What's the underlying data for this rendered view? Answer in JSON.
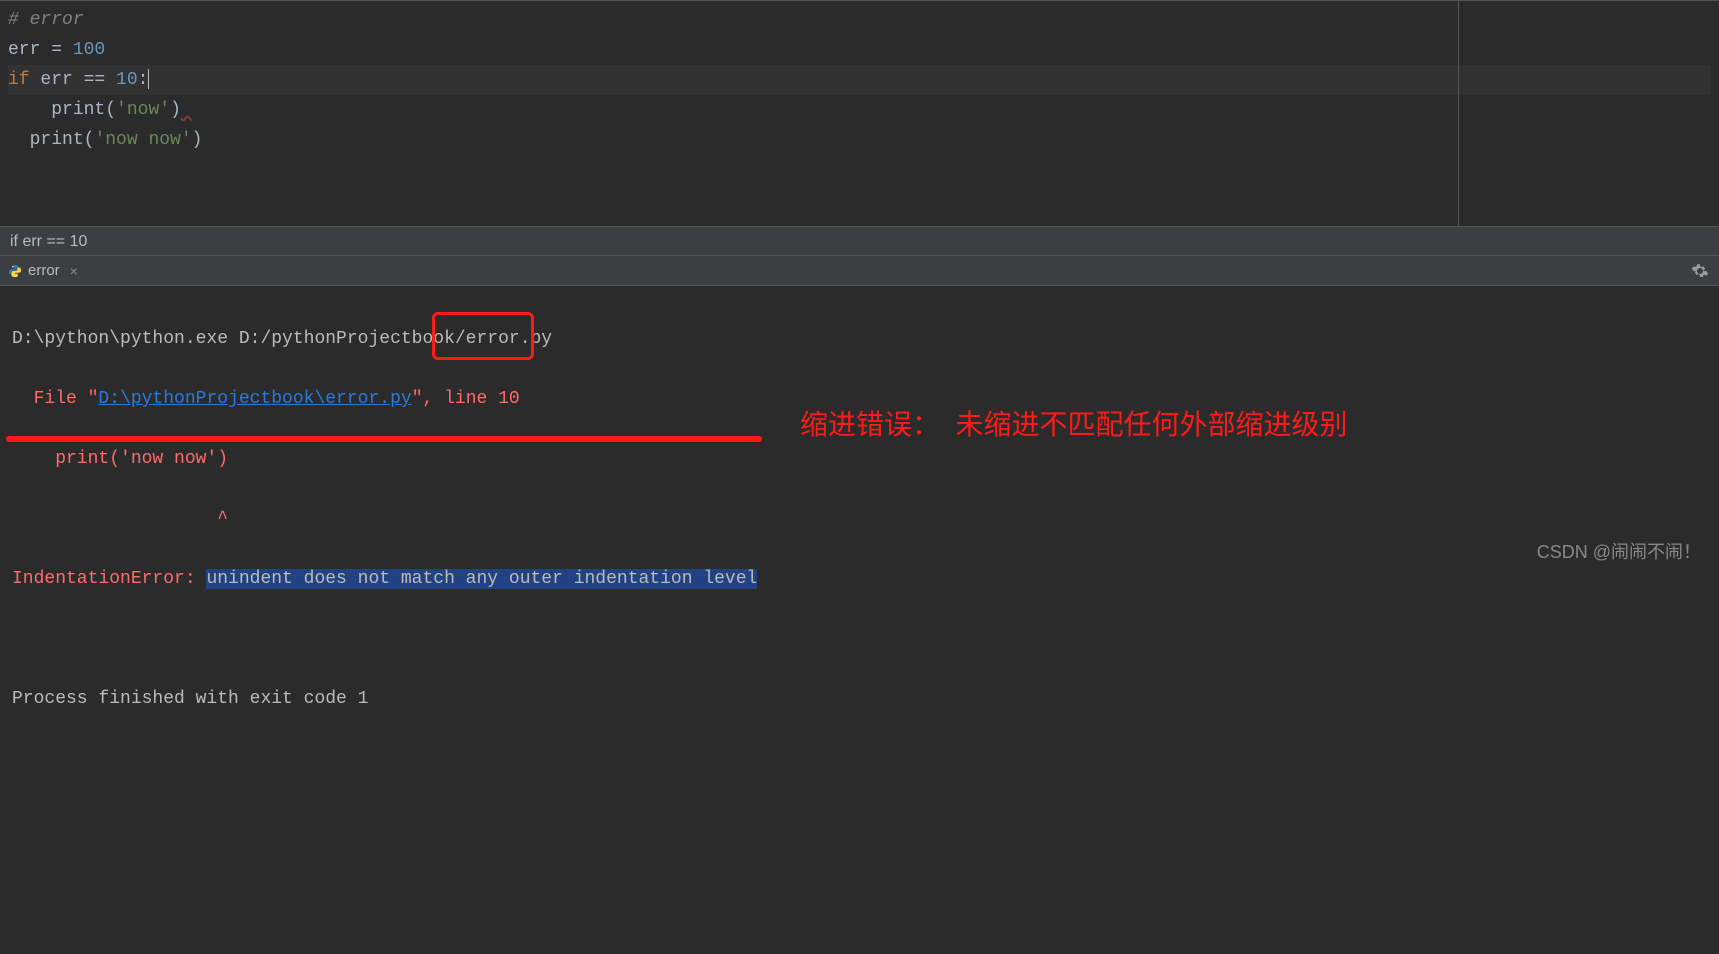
{
  "editor": {
    "comment_prefix": "#",
    "comment_text": " error",
    "line2_var": "err",
    "line2_op": " = ",
    "line2_val": "100",
    "line3_kw": "if",
    "line3_expr": " err == ",
    "line3_val": "10",
    "line3_colon": ":",
    "line4_indent": "    ",
    "line4_func": "print",
    "line4_lp": "(",
    "line4_str": "'now'",
    "line4_rp": ")",
    "line5_indent": "  ",
    "line5_func": "print",
    "line5_lp": "(",
    "line5_str": "'now now'",
    "line5_rp": ")"
  },
  "breadcrumb": {
    "text": "if err == 10"
  },
  "run_tab": {
    "label": "error",
    "close": "×"
  },
  "console": {
    "cmd_prefix": "D:\\python\\python.exe ",
    "cmd_script": "D:/pythonProjectbook/error.py",
    "file_prefix": "  File \"",
    "file_link": "D:\\pythonProjectbook\\error.py",
    "file_mid": "\", ",
    "line_no": "line 10",
    "code_line": "    print('now now')",
    "caret_line": "                   ^",
    "error_name": "IndentationError: ",
    "error_msg": "unindent does not match any outer indentation level",
    "exit_line": "Process finished with exit code 1"
  },
  "annotation": {
    "text": "缩进错误：  未缩进不匹配任何外部缩进级别"
  },
  "watermark": {
    "text": "CSDN @闹闹不闹！"
  }
}
